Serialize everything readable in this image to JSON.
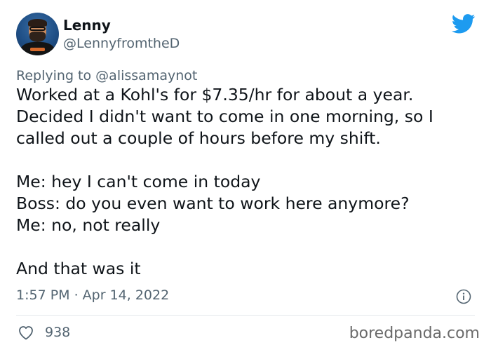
{
  "author": {
    "name": "Lenny",
    "handle": "@LennyfromtheD"
  },
  "reply": {
    "prefix": "Replying to",
    "mention": "@alissamaynot"
  },
  "body_lines": [
    "Worked at a Kohl's for $7.35/hr for about a year.",
    "Decided I didn't want to come in one morning, so I",
    "called out a couple of hours before my shift.",
    "",
    "Me: hey I can't come in today",
    "Boss: do you even want to work here anymore?",
    "Me: no, not really",
    "",
    "And that was it"
  ],
  "timestamp": "1:57 PM · Apr 14, 2022",
  "likes": "938",
  "watermark": "boredpanda.com",
  "icons": {
    "platform": "twitter-bird-icon",
    "info": "info-icon",
    "like": "heart-icon"
  },
  "colors": {
    "twitter_blue": "#1d9bf0",
    "text": "#0f1419",
    "secondary": "#536471"
  }
}
